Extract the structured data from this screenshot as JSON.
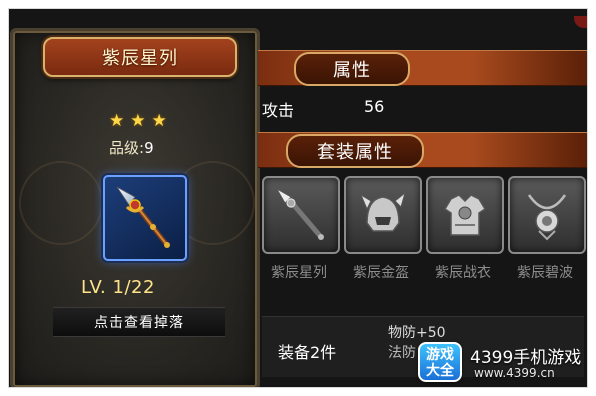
{
  "item": {
    "name": "紫辰星列",
    "stars": [
      "★",
      "★",
      "★"
    ],
    "grade_label": "品级:",
    "grade_value": "9",
    "level": "LV. 1/22",
    "drop_button": "点击查看掉落",
    "icon": "spear-icon"
  },
  "attributes": {
    "section_title": "属性",
    "rows": [
      {
        "name": "攻击",
        "value": "56"
      }
    ]
  },
  "set": {
    "section_title": "套装属性",
    "items": [
      {
        "name": "紫辰星列",
        "icon": "spear-icon"
      },
      {
        "name": "紫辰金盔",
        "icon": "helmet-icon"
      },
      {
        "name": "紫辰战衣",
        "icon": "armor-icon"
      },
      {
        "name": "紫辰碧波",
        "icon": "necklace-icon"
      }
    ],
    "bonus": {
      "count_label": "装备2件",
      "lines": [
        "物防+50",
        "法防"
      ]
    }
  },
  "watermark": {
    "badge": "游戏\n大全",
    "title": "4399手机游戏",
    "url": "www.4399.cn"
  },
  "colors": {
    "banner": "#a84a1e",
    "item_rarity": "#1d3e7a",
    "level_text": "#ffe48a"
  }
}
